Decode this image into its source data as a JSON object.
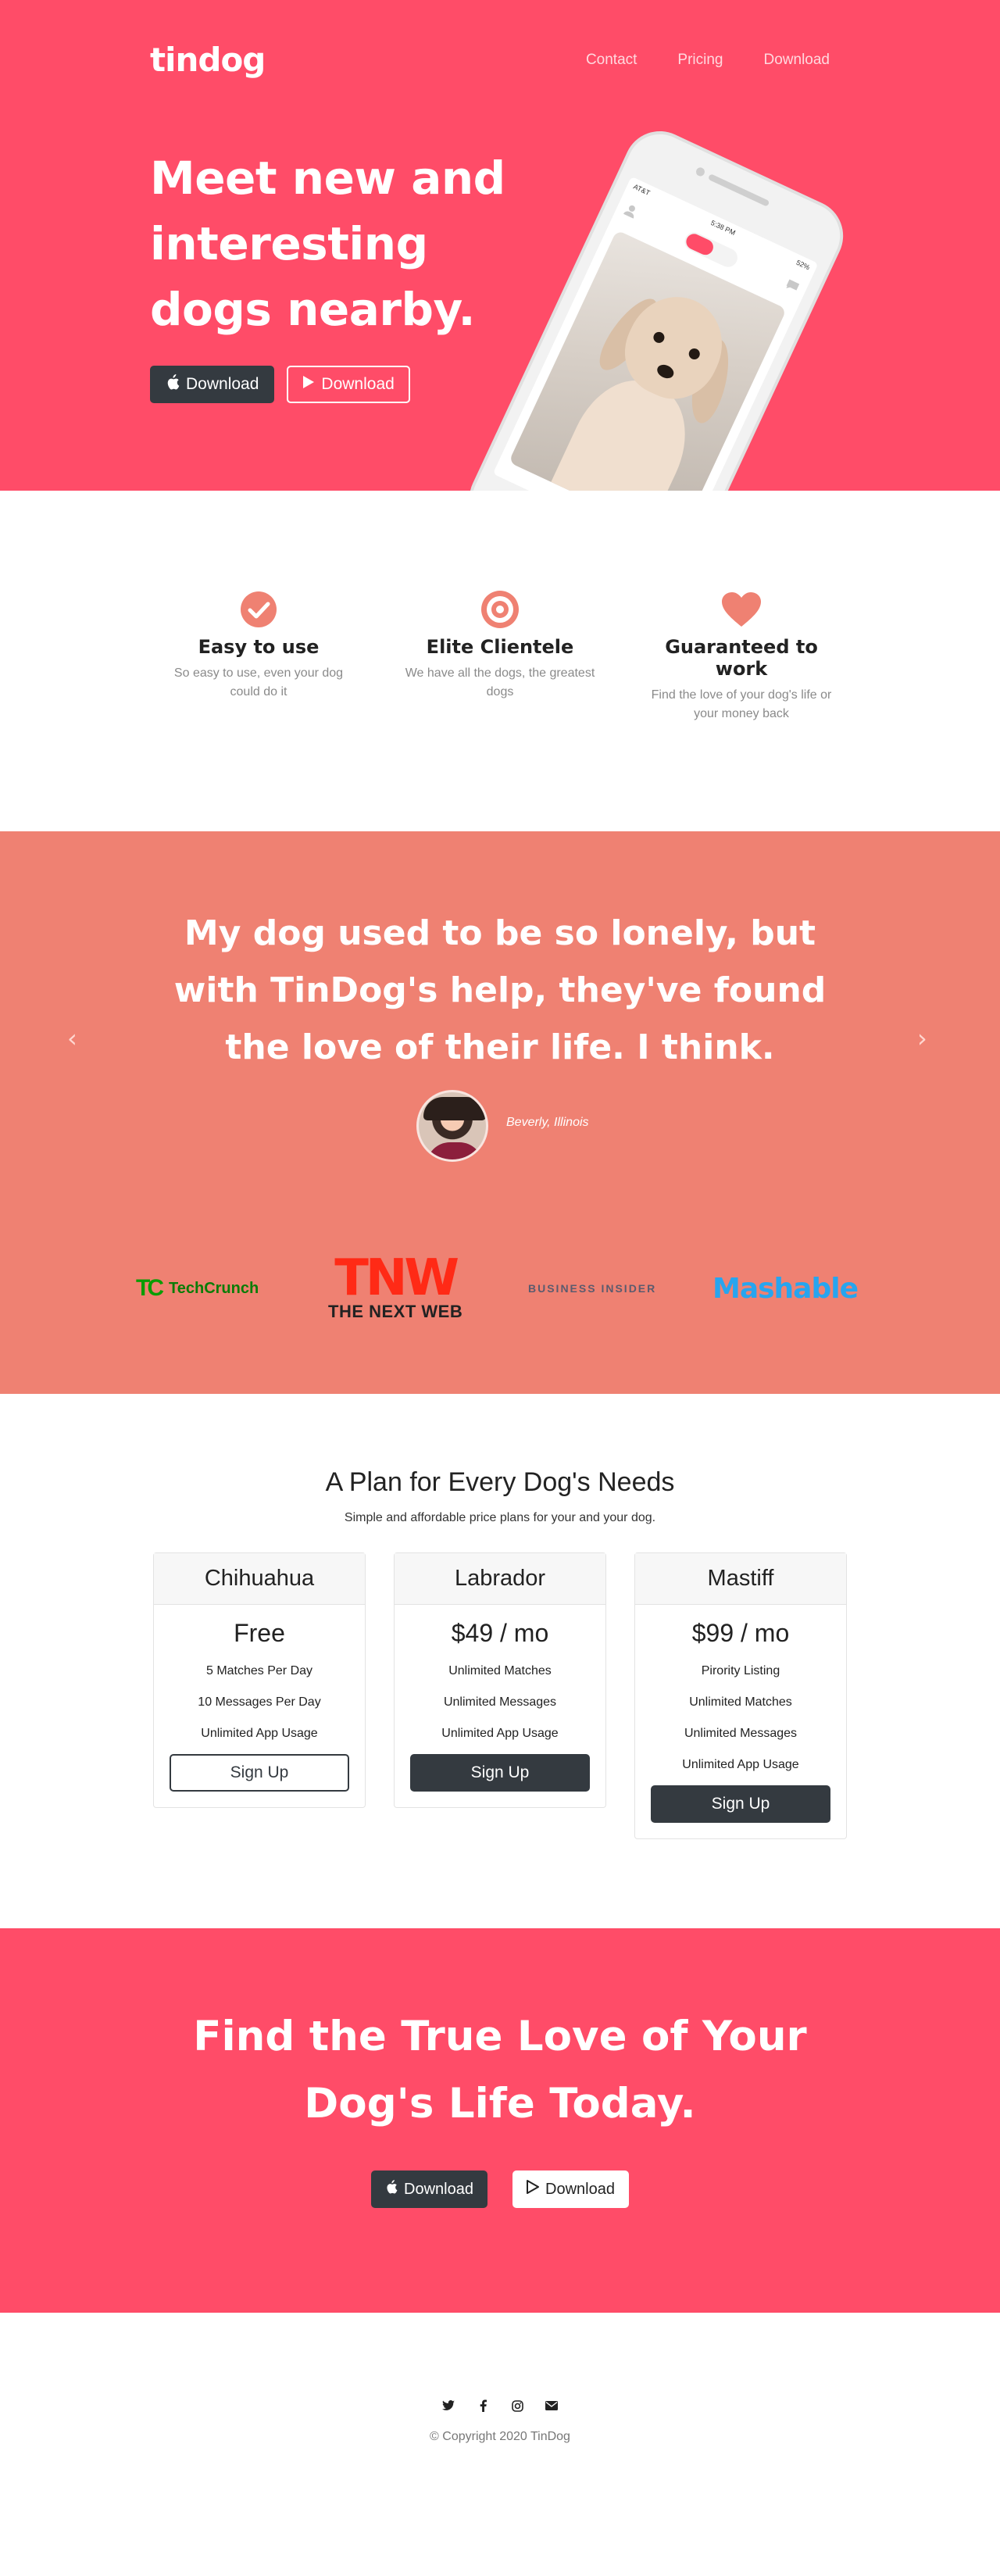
{
  "brand": {
    "logo": "tindog",
    "primary_color": "#ff4c68",
    "secondary_color": "#ef8172",
    "dark_color": "#343a40"
  },
  "nav": {
    "items": [
      "Contact",
      "Pricing",
      "Download"
    ]
  },
  "hero": {
    "title": "Meet new and interesting dogs nearby.",
    "buttons": [
      {
        "label": "Download",
        "icon": "apple-icon"
      },
      {
        "label": "Download",
        "icon": "play-store-icon"
      }
    ],
    "phone": {
      "carrier": "AT&T",
      "time": "5:38 PM",
      "battery": "52%"
    }
  },
  "features": [
    {
      "title": "Easy to use",
      "text": "So easy to use, even your dog could do it",
      "icon": "check-circle-icon"
    },
    {
      "title": "Elite Clientele",
      "text": "We have all the dogs, the greatest dogs",
      "icon": "bullseye-icon"
    },
    {
      "title": "Guaranteed to work",
      "text": "Find the love of your dog's life or your money back",
      "icon": "heart-icon"
    }
  ],
  "testimonial": {
    "quote": "My dog used to be so lonely, but with TinDog's help, they've found the love of their life. I think.",
    "author": "Beverly, Illinois",
    "prev_icon": "chevron-left-icon",
    "next_icon": "chevron-right-icon"
  },
  "press": {
    "techcrunch": {
      "mark": "TC",
      "name": "TechCrunch"
    },
    "tnw": {
      "mark": "TNW",
      "name": "THE NEXT WEB"
    },
    "business_insider": "BUSINESS INSIDER",
    "mashable": "Mashable"
  },
  "pricing": {
    "title": "A Plan for Every Dog's Needs",
    "subtitle": "Simple and affordable price plans for your and your dog.",
    "plans": [
      {
        "name": "Chihuahua",
        "price": "Free",
        "perks": [
          "5 Matches Per Day",
          "10 Messages Per Day",
          "Unlimited App Usage"
        ],
        "cta": "Sign Up"
      },
      {
        "name": "Labrador",
        "price": "$49 / mo",
        "perks": [
          "Unlimited Matches",
          "Unlimited Messages",
          "Unlimited App Usage"
        ],
        "cta": "Sign Up"
      },
      {
        "name": "Mastiff",
        "price": "$99 / mo",
        "perks": [
          "Pirority Listing",
          "Unlimited Matches",
          "Unlimited Messages",
          "Unlimited App Usage"
        ],
        "cta": "Sign Up"
      }
    ]
  },
  "cta": {
    "title": "Find the True Love of Your Dog's Life Today.",
    "buttons": [
      {
        "label": "Download",
        "icon": "apple-icon"
      },
      {
        "label": "Download",
        "icon": "play-store-icon"
      }
    ]
  },
  "footer": {
    "socials": [
      "twitter-icon",
      "facebook-icon",
      "instagram-icon",
      "envelope-icon"
    ],
    "copyright": "© Copyright 2020 TinDog"
  }
}
